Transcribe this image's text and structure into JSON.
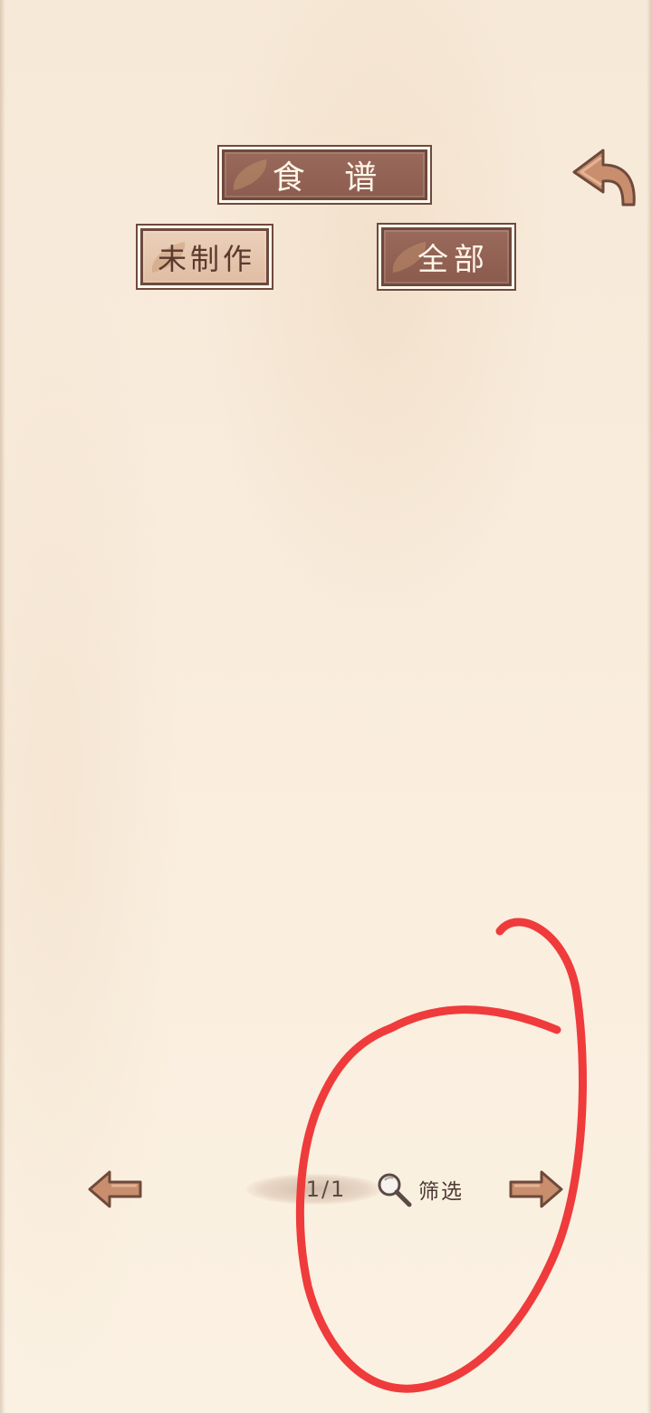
{
  "header": {
    "title": "食 谱"
  },
  "tabs": {
    "unmade_label": "未制作",
    "all_label": "全部"
  },
  "pager": {
    "page_indicator": "1/1",
    "filter_label": "筛选"
  },
  "icons": {
    "back": "back-curved-arrow-icon",
    "prev": "left-arrow-icon",
    "next": "right-arrow-icon",
    "filter": "magnifier-icon"
  },
  "colors": {
    "plaque_dark": "#8b5c4f",
    "plaque_light": "#e6c6ae",
    "plaque_border": "#6e4a3c",
    "arrow": "#c98e6d",
    "annotation": "#ef3b3b"
  }
}
